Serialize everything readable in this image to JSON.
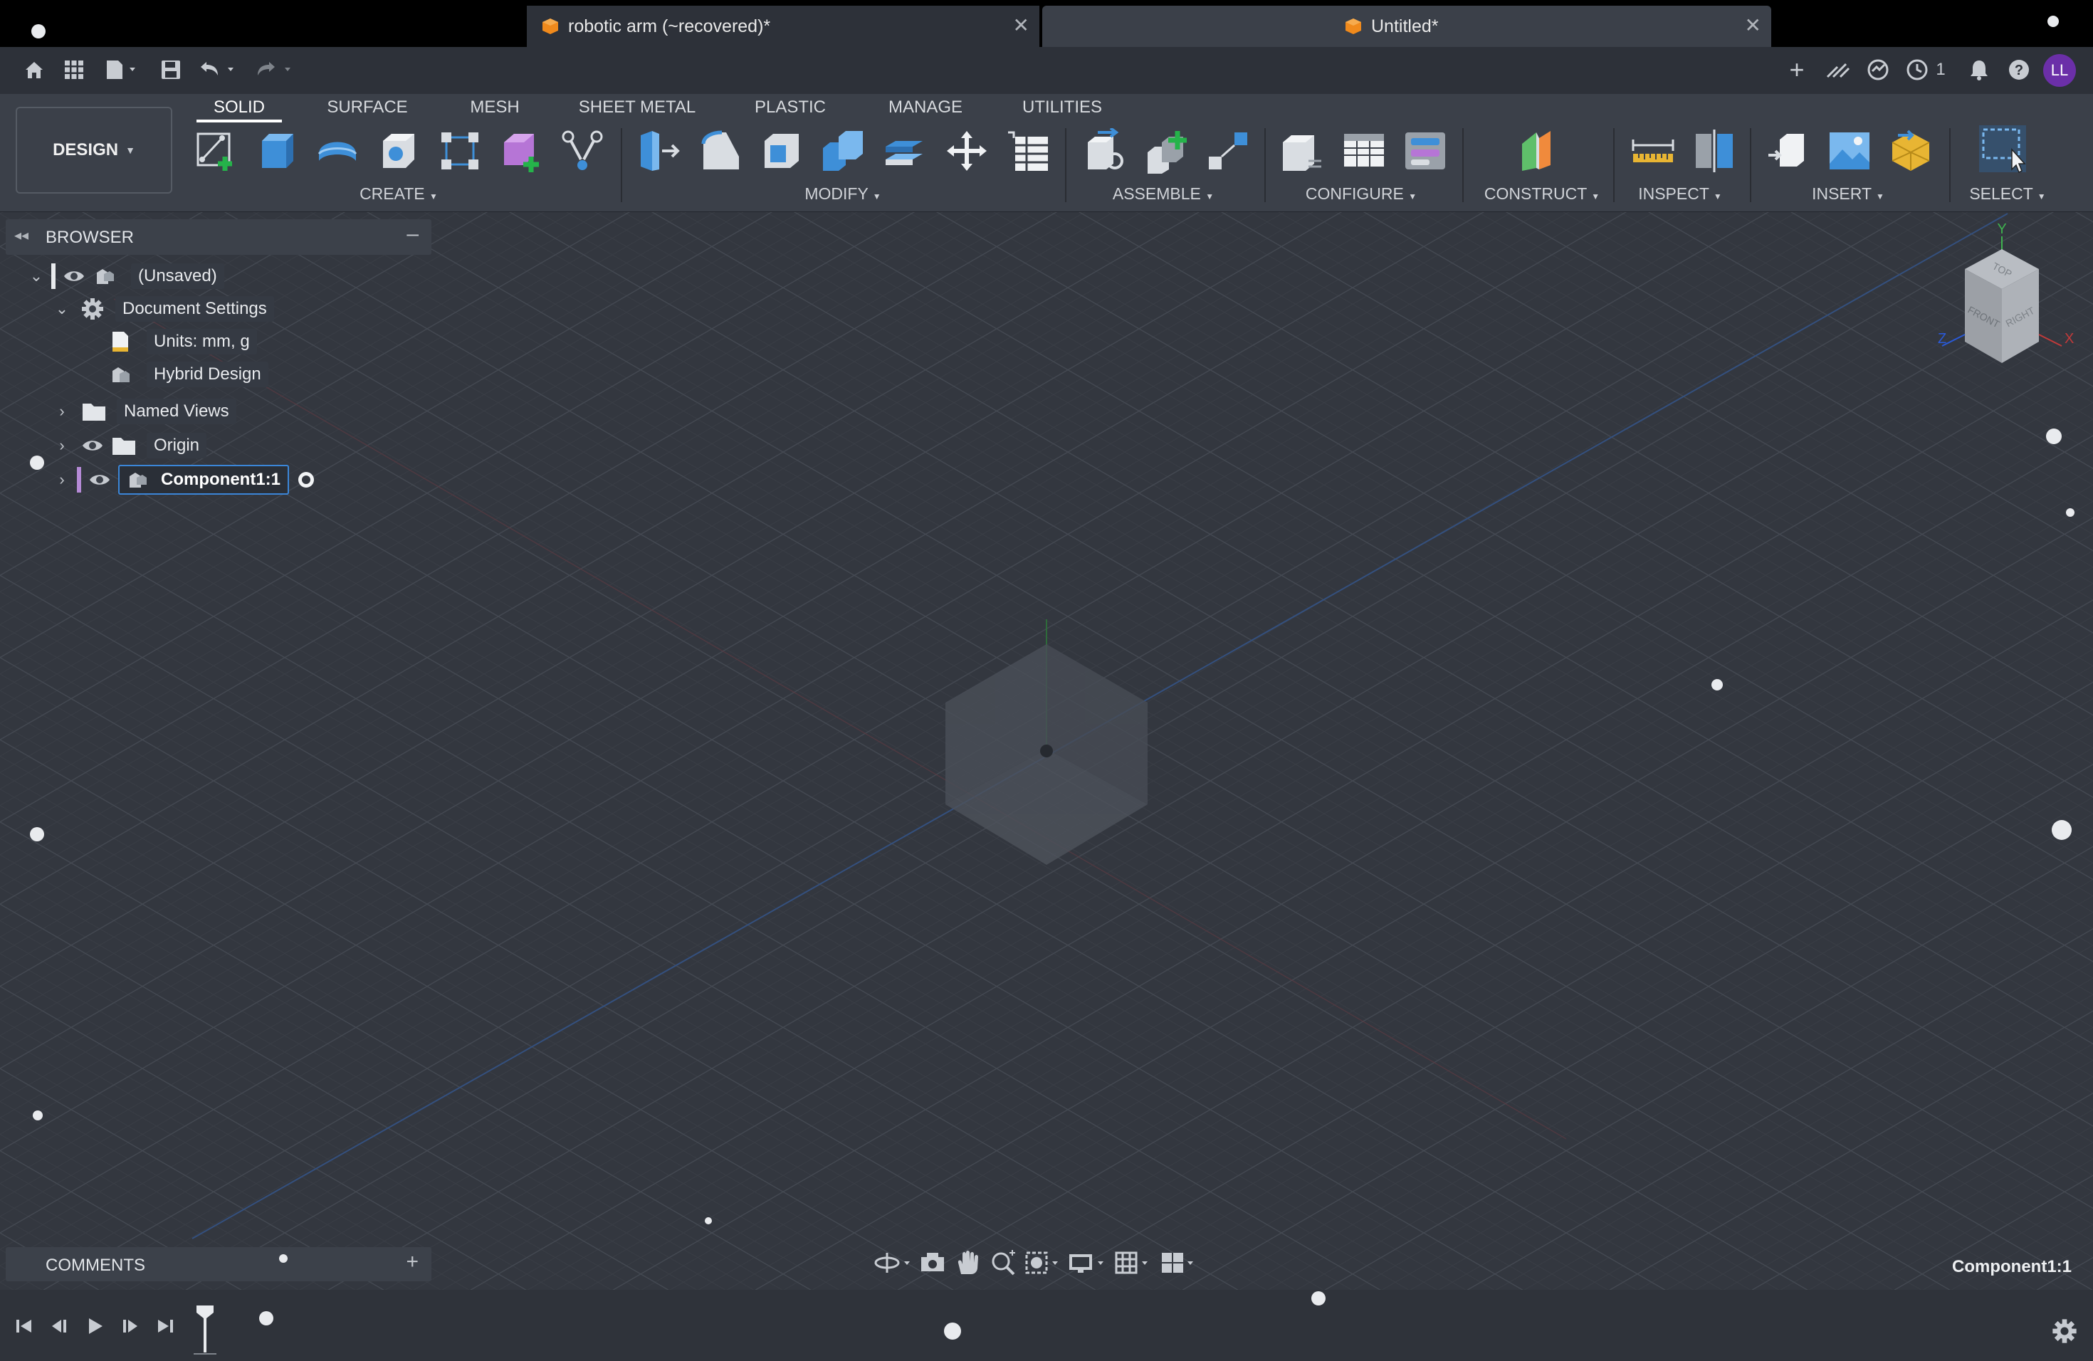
{
  "tabs": [
    {
      "label": "robotic arm (~recovered)*",
      "active": false
    },
    {
      "label": "Untitled*",
      "active": true
    }
  ],
  "header_right": {
    "job_count": "1",
    "user_initials": "LL"
  },
  "workspace": {
    "label": "DESIGN"
  },
  "toolbar_tabs": [
    "SOLID",
    "SURFACE",
    "MESH",
    "SHEET METAL",
    "PLASTIC",
    "MANAGE",
    "UTILITIES"
  ],
  "toolbar_groups": {
    "create": "CREATE",
    "modify": "MODIFY",
    "assemble": "ASSEMBLE",
    "configure": "CONFIGURE",
    "construct": "CONSTRUCT",
    "inspect": "INSPECT",
    "insert": "INSERT",
    "select": "SELECT"
  },
  "browser": {
    "title": "BROWSER",
    "items": [
      {
        "label": "(Unsaved)"
      },
      {
        "label": "Document Settings"
      },
      {
        "label": "Units: mm, g"
      },
      {
        "label": "Hybrid Design"
      },
      {
        "label": "Named Views"
      },
      {
        "label": "Origin"
      },
      {
        "label": "Component1:1"
      }
    ]
  },
  "comments": {
    "title": "COMMENTS"
  },
  "viewcube": {
    "top": "TOP",
    "front": "FRONT",
    "right": "RIGHT",
    "axis_y": "Y",
    "axis_z": "Z",
    "axis_x": "X"
  },
  "status": {
    "active_component": "Component1:1"
  },
  "colors": {
    "accent": "#3b86d8",
    "avatar": "#6b2fa8",
    "viewport": "#33373f"
  }
}
